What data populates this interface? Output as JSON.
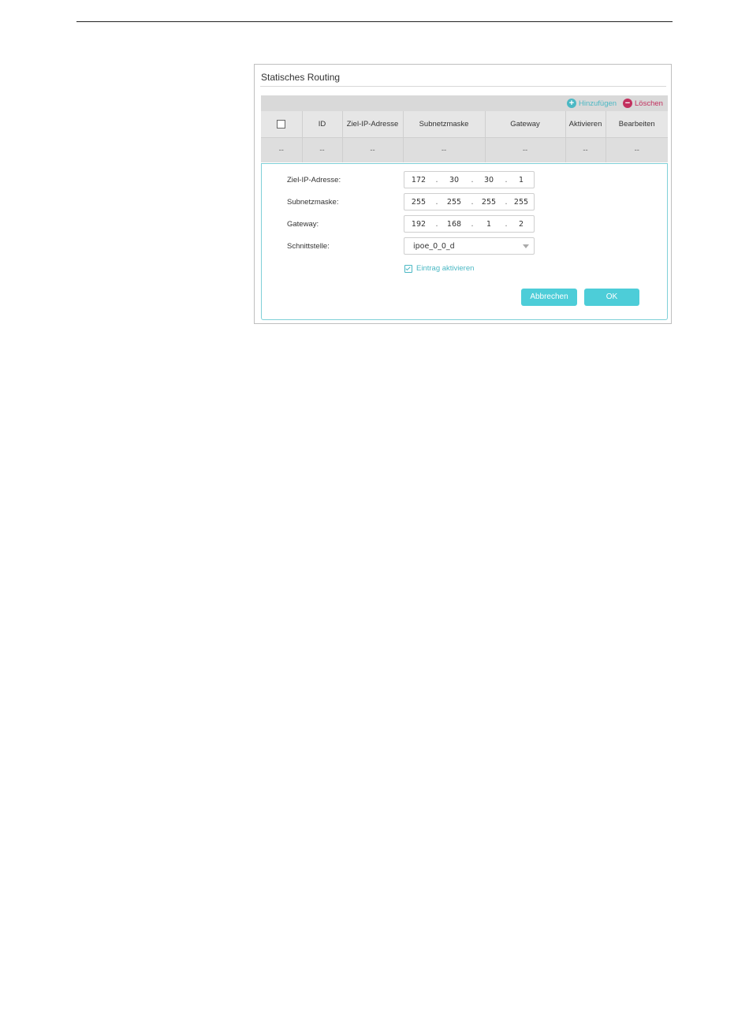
{
  "panel": {
    "title": "Statisches Routing",
    "toolbar": {
      "add_label": "Hinzufügen",
      "add_icon": "plus-circle-icon",
      "delete_label": "Löschen",
      "delete_icon": "minus-circle-icon"
    },
    "table": {
      "columns": [
        "ID",
        "Ziel-IP-Adresse",
        "Subnetzmaske",
        "Gateway",
        "Aktivieren",
        "Bearbeiten"
      ],
      "rows": [
        [
          "--",
          "--",
          "--",
          "--",
          "--",
          "--",
          "--"
        ]
      ]
    },
    "form": {
      "dest_ip_label": "Ziel-IP-Adresse:",
      "dest_ip": [
        "172",
        "30",
        "30",
        "1"
      ],
      "subnet_label": "Subnetzmaske:",
      "subnet": [
        "255",
        "255",
        "255",
        "255"
      ],
      "gateway_label": "Gateway:",
      "gateway": [
        "192",
        "168",
        "1",
        "2"
      ],
      "interface_label": "Schnittstelle:",
      "interface_value": "ipoe_0_0_d",
      "enable_label": "Eintrag aktivieren",
      "enable_checked": true,
      "ip_separator": "."
    },
    "buttons": {
      "cancel_label": "Abbrechen",
      "ok_label": "OK"
    }
  },
  "colors": {
    "accent": "#4dcdd8",
    "add": "#4bb8c4",
    "delete": "#c2305e"
  }
}
